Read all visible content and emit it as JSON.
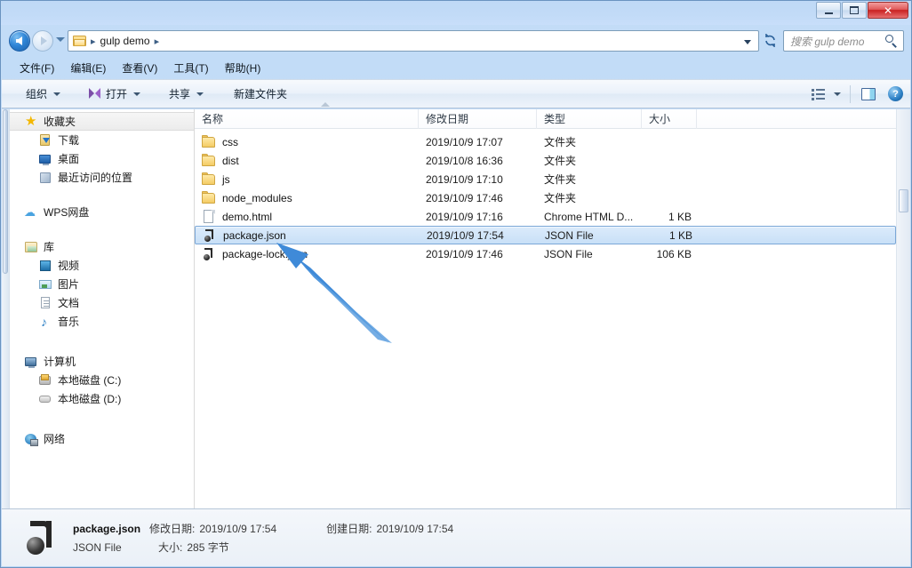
{
  "window": {
    "minimize_label": "—",
    "maximize_label": "❐",
    "close_label": "✕"
  },
  "address": {
    "back_tooltip": "后退",
    "forward_tooltip": "前进",
    "crumb_sep": "▸",
    "path_label": "gulp demo",
    "refresh_label": "↻"
  },
  "search": {
    "placeholder": "搜索 gulp demo"
  },
  "menubar": {
    "items": [
      {
        "label": "文件(F)"
      },
      {
        "label": "编辑(E)"
      },
      {
        "label": "查看(V)"
      },
      {
        "label": "工具(T)"
      },
      {
        "label": "帮助(H)"
      }
    ]
  },
  "toolbar": {
    "organize_label": "组织",
    "open_label": "打开",
    "share_label": "共享",
    "new_folder_label": "新建文件夹",
    "help_label": "?"
  },
  "sidebar": {
    "groups": [
      {
        "items": [
          {
            "label": "收藏夹",
            "icon": "star-icon",
            "indent": false,
            "selected": true
          },
          {
            "label": "下载",
            "icon": "download-icon",
            "indent": true,
            "selected": false
          },
          {
            "label": "桌面",
            "icon": "desktop-icon",
            "indent": true,
            "selected": false
          },
          {
            "label": "最近访问的位置",
            "icon": "recent-places-icon",
            "indent": true,
            "selected": false
          }
        ]
      },
      {
        "items": [
          {
            "label": "WPS网盘",
            "icon": "cloud-icon",
            "indent": false,
            "selected": false
          }
        ]
      },
      {
        "items": [
          {
            "label": "库",
            "icon": "library-icon",
            "indent": false,
            "selected": false
          },
          {
            "label": "视频",
            "icon": "video-icon",
            "indent": true,
            "selected": false
          },
          {
            "label": "图片",
            "icon": "picture-icon",
            "indent": true,
            "selected": false
          },
          {
            "label": "文档",
            "icon": "document-icon",
            "indent": true,
            "selected": false
          },
          {
            "label": "音乐",
            "icon": "music-icon",
            "indent": true,
            "selected": false
          }
        ]
      },
      {
        "items": [
          {
            "label": "计算机",
            "icon": "computer-icon",
            "indent": false,
            "selected": false
          },
          {
            "label": "本地磁盘 (C:)",
            "icon": "disk-c-icon",
            "indent": true,
            "selected": false
          },
          {
            "label": "本地磁盘 (D:)",
            "icon": "disk-d-icon",
            "indent": true,
            "selected": false
          }
        ]
      },
      {
        "items": [
          {
            "label": "网络",
            "icon": "network-icon",
            "indent": false,
            "selected": false
          }
        ]
      }
    ]
  },
  "filelist": {
    "columns": {
      "name": "名称",
      "date": "修改日期",
      "type": "类型",
      "size": "大小"
    },
    "sort_column": "name",
    "sort_direction": "asc",
    "rows": [
      {
        "name": "css",
        "date": "2019/10/9 17:07",
        "type": "文件夹",
        "size": "",
        "icon": "folder-icon",
        "selected": false
      },
      {
        "name": "dist",
        "date": "2019/10/8 16:36",
        "type": "文件夹",
        "size": "",
        "icon": "folder-icon",
        "selected": false
      },
      {
        "name": "js",
        "date": "2019/10/9 17:10",
        "type": "文件夹",
        "size": "",
        "icon": "folder-icon",
        "selected": false
      },
      {
        "name": "node_modules",
        "date": "2019/10/9 17:46",
        "type": "文件夹",
        "size": "",
        "icon": "folder-icon",
        "selected": false
      },
      {
        "name": "demo.html",
        "date": "2019/10/9 17:16",
        "type": "Chrome HTML D...",
        "size": "1 KB",
        "icon": "html-file-icon",
        "selected": false
      },
      {
        "name": "package.json",
        "date": "2019/10/9 17:54",
        "type": "JSON File",
        "size": "1 KB",
        "icon": "json-file-icon",
        "selected": true
      },
      {
        "name": "package-lock.json",
        "date": "2019/10/9 17:46",
        "type": "JSON File",
        "size": "106 KB",
        "icon": "json-file-icon",
        "selected": false
      }
    ]
  },
  "annotation": {
    "arrow_color": "#3f8ad8",
    "points_to": "package.json"
  },
  "statusbar": {
    "file_name": "package.json",
    "modified_label": "修改日期:",
    "modified_value": "2019/10/9 17:54",
    "created_label": "创建日期:",
    "created_value": "2019/10/9 17:54",
    "file_type": "JSON File",
    "size_label": "大小:",
    "size_value": "285 字节"
  }
}
